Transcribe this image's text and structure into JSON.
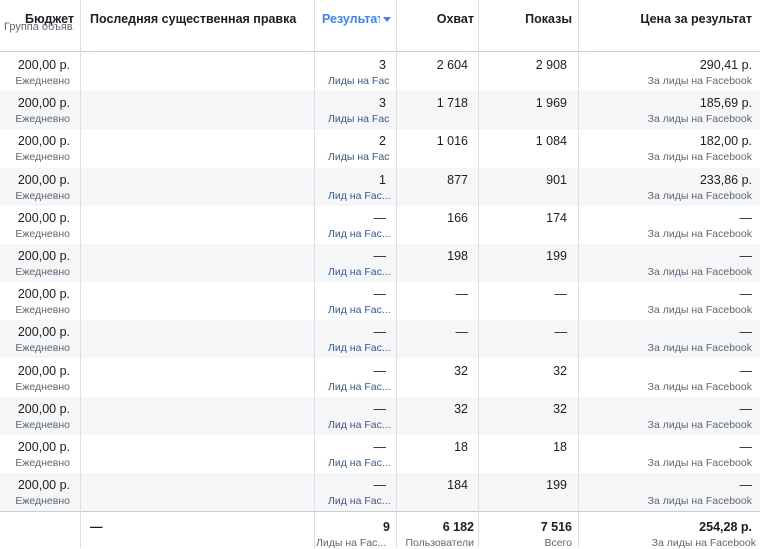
{
  "headers": {
    "budget": "Бюджет",
    "budget_sub": "Группа объяв...",
    "last_edit": "Последняя существенная правка",
    "results": "Результаты",
    "reach": "Охват",
    "impressions": "Показы",
    "cost_per_result": "Цена за результат"
  },
  "rows": [
    {
      "budget": "200,00 р.",
      "budget_sub": "Ежедневно",
      "results": "3",
      "results_sub": "Лиды на Fac...",
      "reach": "2 604",
      "impressions": "2 908",
      "cost": "290,41 р.",
      "cost_sub": "За лиды на Facebook"
    },
    {
      "budget": "200,00 р.",
      "budget_sub": "Ежедневно",
      "results": "3",
      "results_sub": "Лиды на Fac...",
      "reach": "1 718",
      "impressions": "1 969",
      "cost": "185,69 р.",
      "cost_sub": "За лиды на Facebook"
    },
    {
      "budget": "200,00 р.",
      "budget_sub": "Ежедневно",
      "results": "2",
      "results_sub": "Лиды на Fac...",
      "reach": "1 016",
      "impressions": "1 084",
      "cost": "182,00 р.",
      "cost_sub": "За лиды на Facebook"
    },
    {
      "budget": "200,00 р.",
      "budget_sub": "Ежедневно",
      "results": "1",
      "results_sub": "Лид на Fac...",
      "reach": "877",
      "impressions": "901",
      "cost": "233,86 р.",
      "cost_sub": "За лиды на Facebook"
    },
    {
      "budget": "200,00 р.",
      "budget_sub": "Ежедневно",
      "results": "—",
      "results_sub": "Лид на Fac...",
      "reach": "166",
      "impressions": "174",
      "cost": "—",
      "cost_sub": "За лиды на Facebook"
    },
    {
      "budget": "200,00 р.",
      "budget_sub": "Ежедневно",
      "results": "—",
      "results_sub": "Лид на Fac...",
      "reach": "198",
      "impressions": "199",
      "cost": "—",
      "cost_sub": "За лиды на Facebook"
    },
    {
      "budget": "200,00 р.",
      "budget_sub": "Ежедневно",
      "results": "—",
      "results_sub": "Лид на Fac...",
      "reach": "—",
      "impressions": "—",
      "cost": "—",
      "cost_sub": "За лиды на Facebook"
    },
    {
      "budget": "200,00 р.",
      "budget_sub": "Ежедневно",
      "results": "—",
      "results_sub": "Лид на Fac...",
      "reach": "—",
      "impressions": "—",
      "cost": "—",
      "cost_sub": "За лиды на Facebook"
    },
    {
      "budget": "200,00 р.",
      "budget_sub": "Ежедневно",
      "results": "—",
      "results_sub": "Лид на Fac...",
      "reach": "32",
      "impressions": "32",
      "cost": "—",
      "cost_sub": "За лиды на Facebook"
    },
    {
      "budget": "200,00 р.",
      "budget_sub": "Ежедневно",
      "results": "—",
      "results_sub": "Лид на Fac...",
      "reach": "32",
      "impressions": "32",
      "cost": "—",
      "cost_sub": "За лиды на Facebook"
    },
    {
      "budget": "200,00 р.",
      "budget_sub": "Ежедневно",
      "results": "—",
      "results_sub": "Лид на Fac...",
      "reach": "18",
      "impressions": "18",
      "cost": "—",
      "cost_sub": "За лиды на Facebook"
    },
    {
      "budget": "200,00 р.",
      "budget_sub": "Ежедневно",
      "results": "—",
      "results_sub": "Лид на Fac...",
      "reach": "184",
      "impressions": "199",
      "cost": "—",
      "cost_sub": "За лиды на Facebook"
    }
  ],
  "totals": {
    "last_edit": "—",
    "results": "9",
    "results_sub": "Лиды на Fac...",
    "reach": "6 182",
    "reach_sub": "Пользователи",
    "impressions": "7 516",
    "impressions_sub": "Всего",
    "cost": "254,28 р.",
    "cost_sub": "За лиды на Facebook"
  },
  "colors": {
    "link": "#385898",
    "sort_accent": "#4080ff",
    "row_alt": "#f5f6f7",
    "grid": "#dddfe2"
  }
}
